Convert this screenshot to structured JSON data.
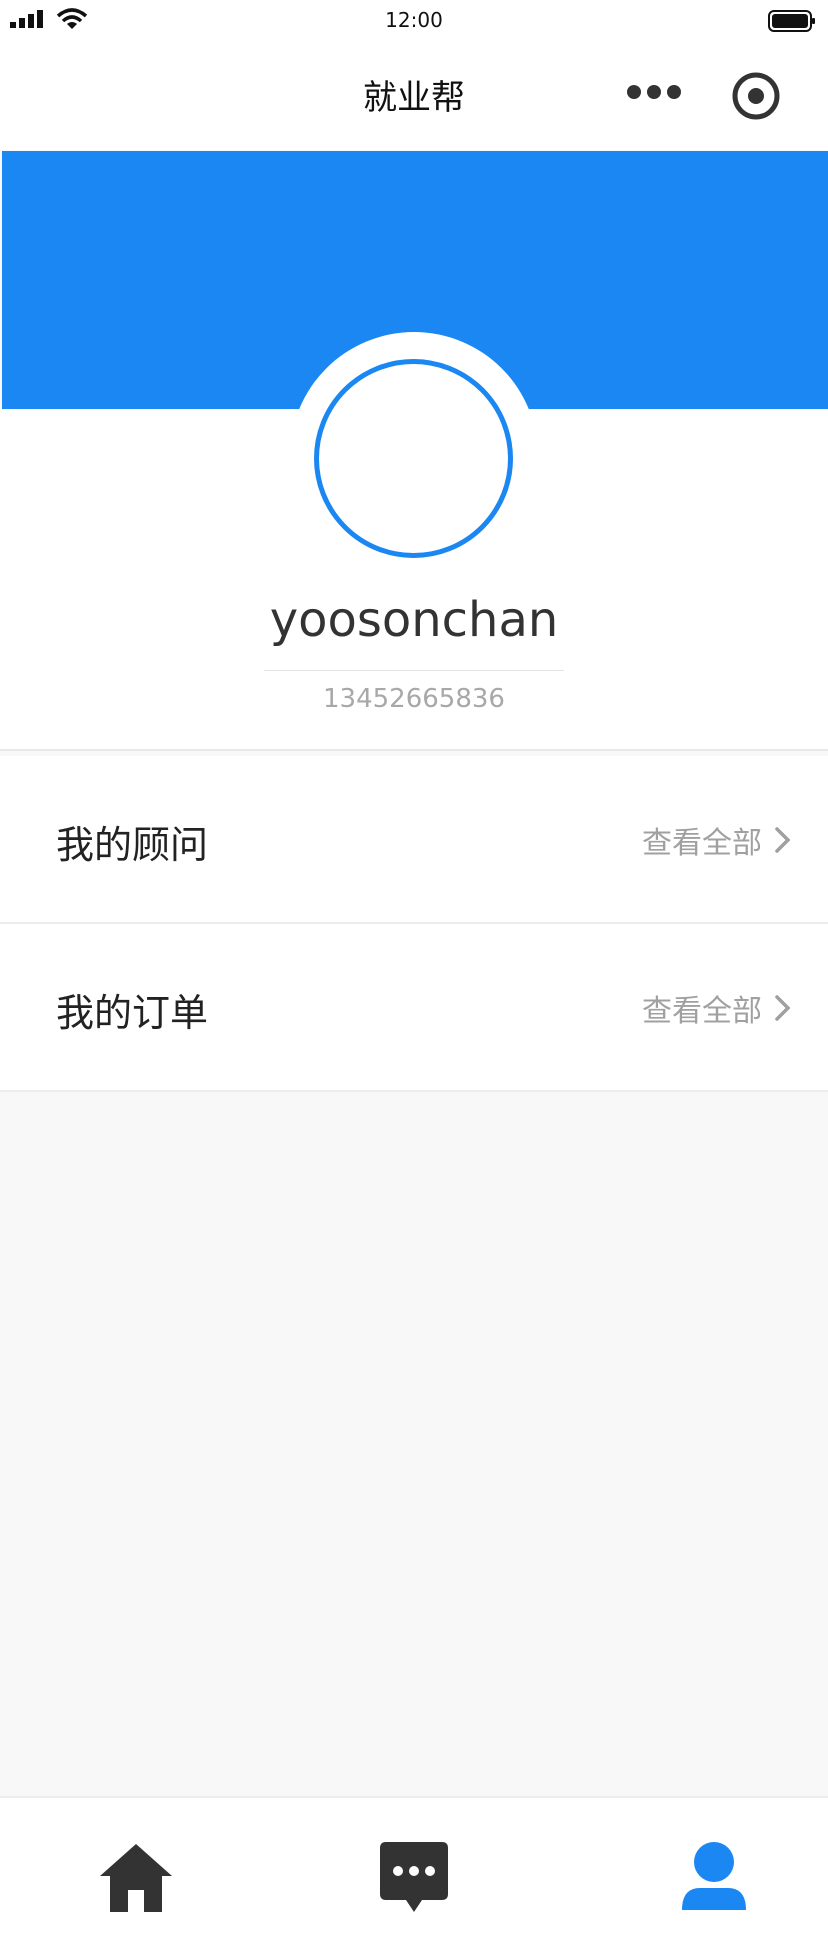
{
  "status_bar": {
    "time": "12:00"
  },
  "nav": {
    "title": "就业帮",
    "more_icon": "more-dots-icon",
    "target_icon": "target-icon"
  },
  "profile": {
    "username": "yoosonchan",
    "phone": "13452665836"
  },
  "sections": [
    {
      "title": "我的顾问",
      "link_label": "查看全部"
    },
    {
      "title": "我的订单",
      "link_label": "查看全部"
    }
  ],
  "tab_bar": {
    "items": [
      {
        "icon": "home-icon",
        "active": false
      },
      {
        "icon": "message-icon",
        "active": false
      },
      {
        "icon": "user-icon",
        "active": true
      }
    ]
  },
  "colors": {
    "accent": "#1a87f2",
    "inactive_icon": "#333333",
    "background": "#f8f8f8"
  }
}
